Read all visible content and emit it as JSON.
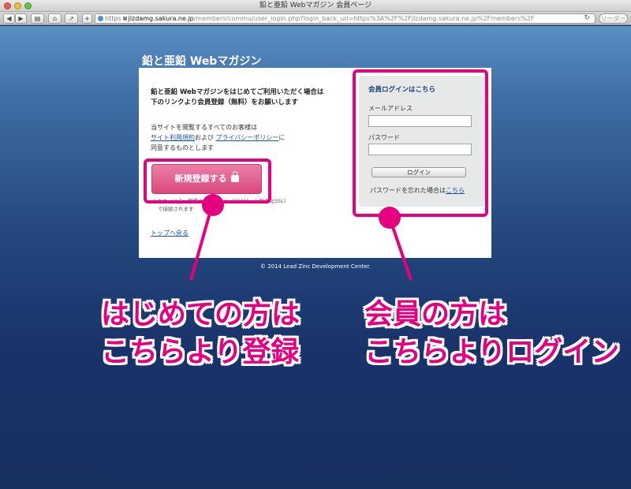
{
  "window": {
    "title": "鉛と亜鉛 Webマガジン 会員ページ"
  },
  "toolbar": {
    "back": "◀",
    "forward": "▶",
    "reader": "リーダー",
    "url_scheme": "https",
    "url_host": "jlzdamg.sakura.ne.jp",
    "url_path": "/members/commu/user_login.php?login_back_url=https%3A%2F%2Fjlzdamg.sakura.ne.jp%2Fmembers%2F",
    "reload": "↻"
  },
  "site": {
    "title": "鉛と亜鉛 Webマガジン",
    "footer": "© 2014 Lead Zinc Development Center."
  },
  "register": {
    "intro_line1": "鉛と亜鉛 Webマガジンをはじめてご利用いただく場合は",
    "intro_line2": "下のリンクより会員登録（無料）をお願いします",
    "notice_line1": "当サイトを閲覧するすべてのお客様は",
    "terms_link": "サイト利用規約",
    "notice_and": "および",
    "privacy_link": "プライバシーポリシー",
    "notice_ni": "に",
    "notice_line3": "同意するものとします",
    "button_label": "新規登録する",
    "ssl_line1": "※セキュリティ保護されたページ（256ビット暗号化SSL）",
    "ssl_line2": "で接続されます",
    "top_link": "トップへ戻る"
  },
  "login": {
    "title": "会員ログインはこちら",
    "email_label": "メールアドレス",
    "email_value": "",
    "password_label": "パスワード",
    "password_value": "",
    "button_label": "ログイン",
    "forgot_text": "パスワードを忘れた場合は",
    "forgot_link": "こちら"
  },
  "annotations": {
    "left_line1": "はじめての方は",
    "left_line2": "こちらより登録",
    "right_line1": "会員の方は",
    "right_line2": "こちらよりログイン",
    "color": "#e4007f"
  }
}
